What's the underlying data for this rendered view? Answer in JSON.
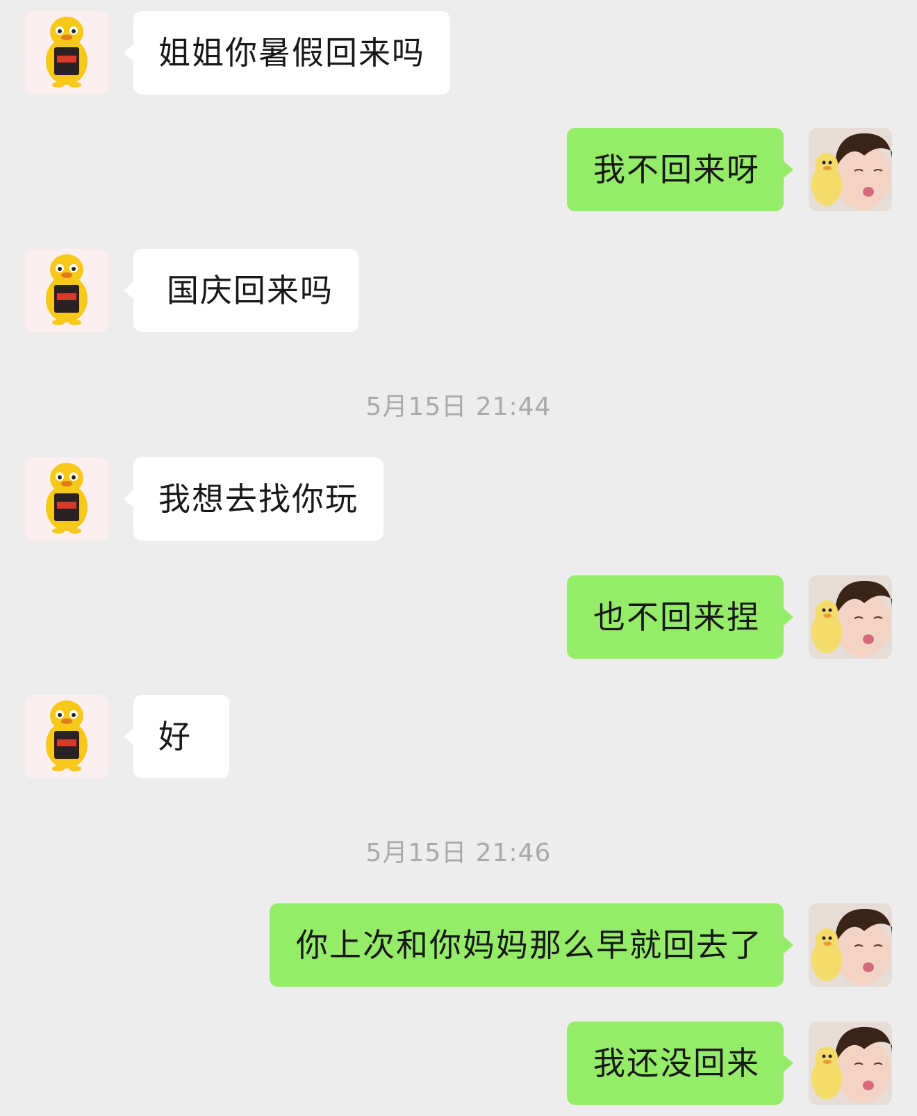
{
  "colors": {
    "background": "#ededed",
    "incoming_bubble": "#ffffff",
    "outgoing_bubble": "#95ec69",
    "timestamp_text": "#a9a9a9"
  },
  "contacts": {
    "incoming_avatar": "yellow-mascot-avatar-icon",
    "outgoing_avatar": "child-with-duck-avatar-icon"
  },
  "messages": [
    {
      "side": "left",
      "text": "姐姐你暑假回来吗"
    },
    {
      "side": "right",
      "text": "我不回来呀"
    },
    {
      "side": "left",
      "text": "国庆回来吗"
    },
    {
      "side": "left",
      "text": "我想去找你玩"
    },
    {
      "side": "right",
      "text": "也不回来捏"
    },
    {
      "side": "left",
      "text": "好"
    },
    {
      "side": "right",
      "text": "你上次和你妈妈那么早就回去了"
    },
    {
      "side": "right",
      "text": "我还没回来"
    }
  ],
  "timestamps": [
    {
      "text": "5月15日 21:44"
    },
    {
      "text": "5月15日 21:46"
    }
  ]
}
